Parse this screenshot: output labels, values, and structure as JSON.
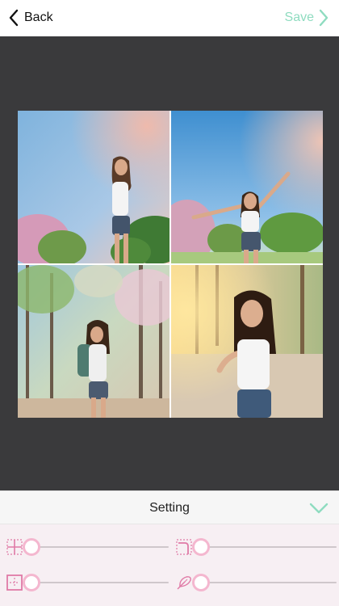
{
  "nav": {
    "back_label": "Back",
    "save_label": "Save",
    "back_icon": "chevron-left-icon",
    "save_icon": "chevron-right-icon"
  },
  "collage": {
    "cells": [
      {
        "name": "photo-1",
        "description_icon": "photo"
      },
      {
        "name": "photo-2",
        "description_icon": "photo"
      },
      {
        "name": "photo-3",
        "description_icon": "photo"
      },
      {
        "name": "photo-4",
        "description_icon": "photo"
      }
    ]
  },
  "settings": {
    "title": "Setting",
    "confirm_icon": "checkmark-icon",
    "controls": [
      {
        "icon": "inner-border-icon",
        "value": 0
      },
      {
        "icon": "corner-radius-icon",
        "value": 0
      },
      {
        "icon": "outer-border-icon",
        "value": 0
      },
      {
        "icon": "feather-icon",
        "value": 0
      }
    ]
  },
  "colors": {
    "accent": "#8fdcc0",
    "slider_knob": "#f4b7cf",
    "icon_pink": "#e07aa6",
    "canvas_bg": "#3a3a3c",
    "panel_bg": "#f7eff3"
  }
}
